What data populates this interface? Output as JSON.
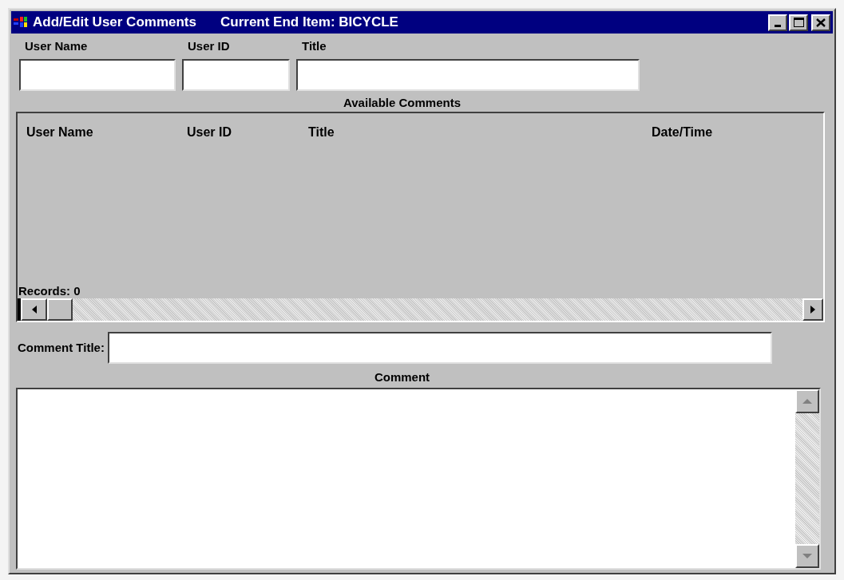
{
  "window": {
    "title": "Add/Edit User Comments",
    "subtitle": "Current End Item: BICYCLE"
  },
  "header_fields": [
    {
      "label": "User Name"
    },
    {
      "label": "User ID"
    },
    {
      "label": "Title"
    }
  ],
  "available_comments": {
    "heading": "Available Comments",
    "columns": [
      "User Name",
      "User ID",
      "Title",
      "Date/Time"
    ],
    "records": "Records: 0"
  },
  "comment_title": {
    "label": "Comment Title:"
  },
  "comment": {
    "heading": "Comment"
  }
}
